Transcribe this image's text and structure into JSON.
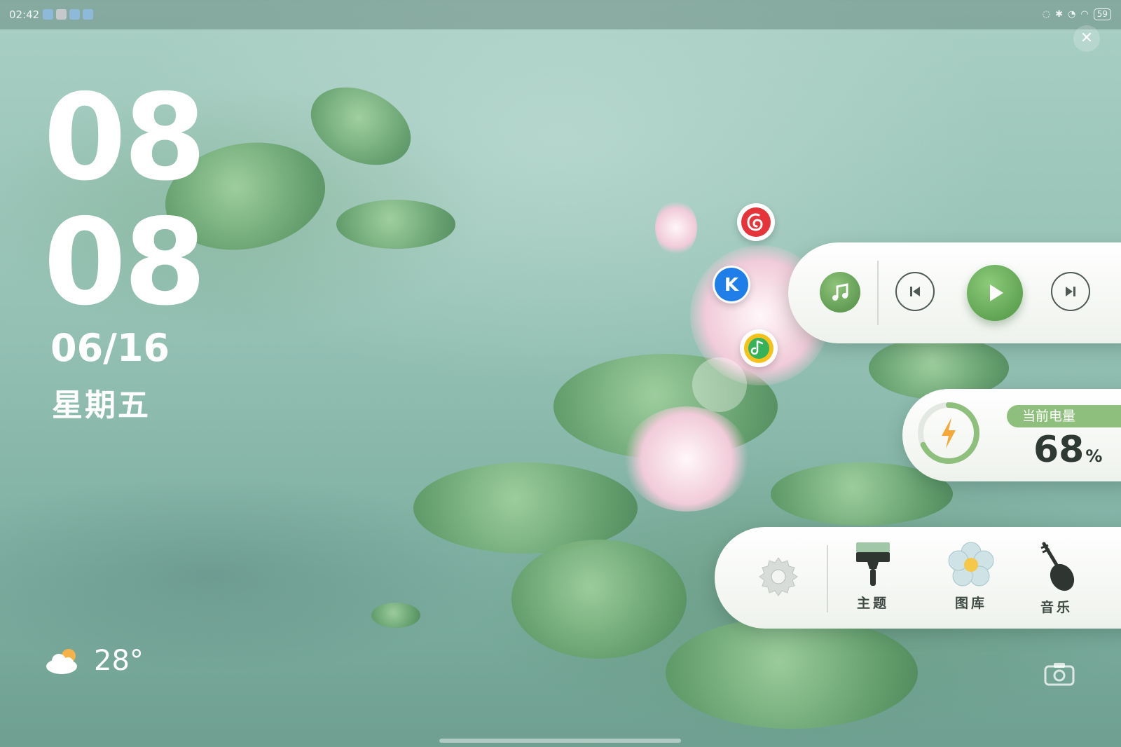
{
  "status_bar": {
    "time": "02:42",
    "battery": "59"
  },
  "lockscreen": {
    "hour": "08",
    "minute": "08",
    "date": "06/16",
    "weekday": "星期五"
  },
  "weather": {
    "icon": "partly-cloudy-icon",
    "temperature": "28°"
  },
  "music_apps": [
    {
      "name": "netease-cloud-music-icon",
      "color": "#e5343a"
    },
    {
      "name": "kugou-music-icon",
      "color": "#1f7ee8",
      "glyph": "K"
    },
    {
      "name": "qq-music-icon",
      "color": "#f4c21a"
    }
  ],
  "music_widget": {
    "accent": "#5a9a4e"
  },
  "battery_widget": {
    "label": "当前电量",
    "value": "68",
    "unit": "%",
    "level": 0.68,
    "accent": "#8fbf7c"
  },
  "dock": {
    "items": [
      {
        "name": "theme",
        "label": "主题"
      },
      {
        "name": "gallery",
        "label": "图库"
      },
      {
        "name": "music",
        "label": "音乐"
      }
    ]
  }
}
